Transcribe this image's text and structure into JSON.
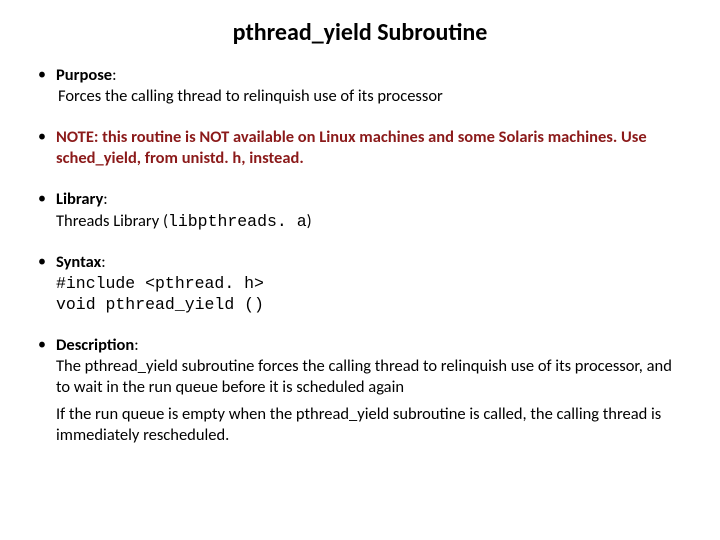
{
  "title": "pthread_yield Subroutine",
  "items": {
    "purpose": {
      "label": "Purpose",
      "text": "Forces the calling thread to relinquish use of its processor"
    },
    "note": {
      "text": "NOTE:  this routine is NOT available on Linux machines and some Solaris machines.   Use  sched_yield, from unistd. h,  instead."
    },
    "library": {
      "label": "Library",
      "prefix": "Threads Library (",
      "code": "libpthreads. a",
      "suffix": ")"
    },
    "syntax": {
      "label": "Syntax",
      "line1": "#include <pthread. h>",
      "line2": "void pthread_yield ()"
    },
    "description": {
      "label": "Description",
      "p1": "The pthread_yield subroutine forces the calling thread to relinquish use of its processor, and to wait in the run queue before it is scheduled again",
      "p2": "If the run queue is empty when the pthread_yield subroutine is called, the calling thread is immediately rescheduled."
    }
  }
}
